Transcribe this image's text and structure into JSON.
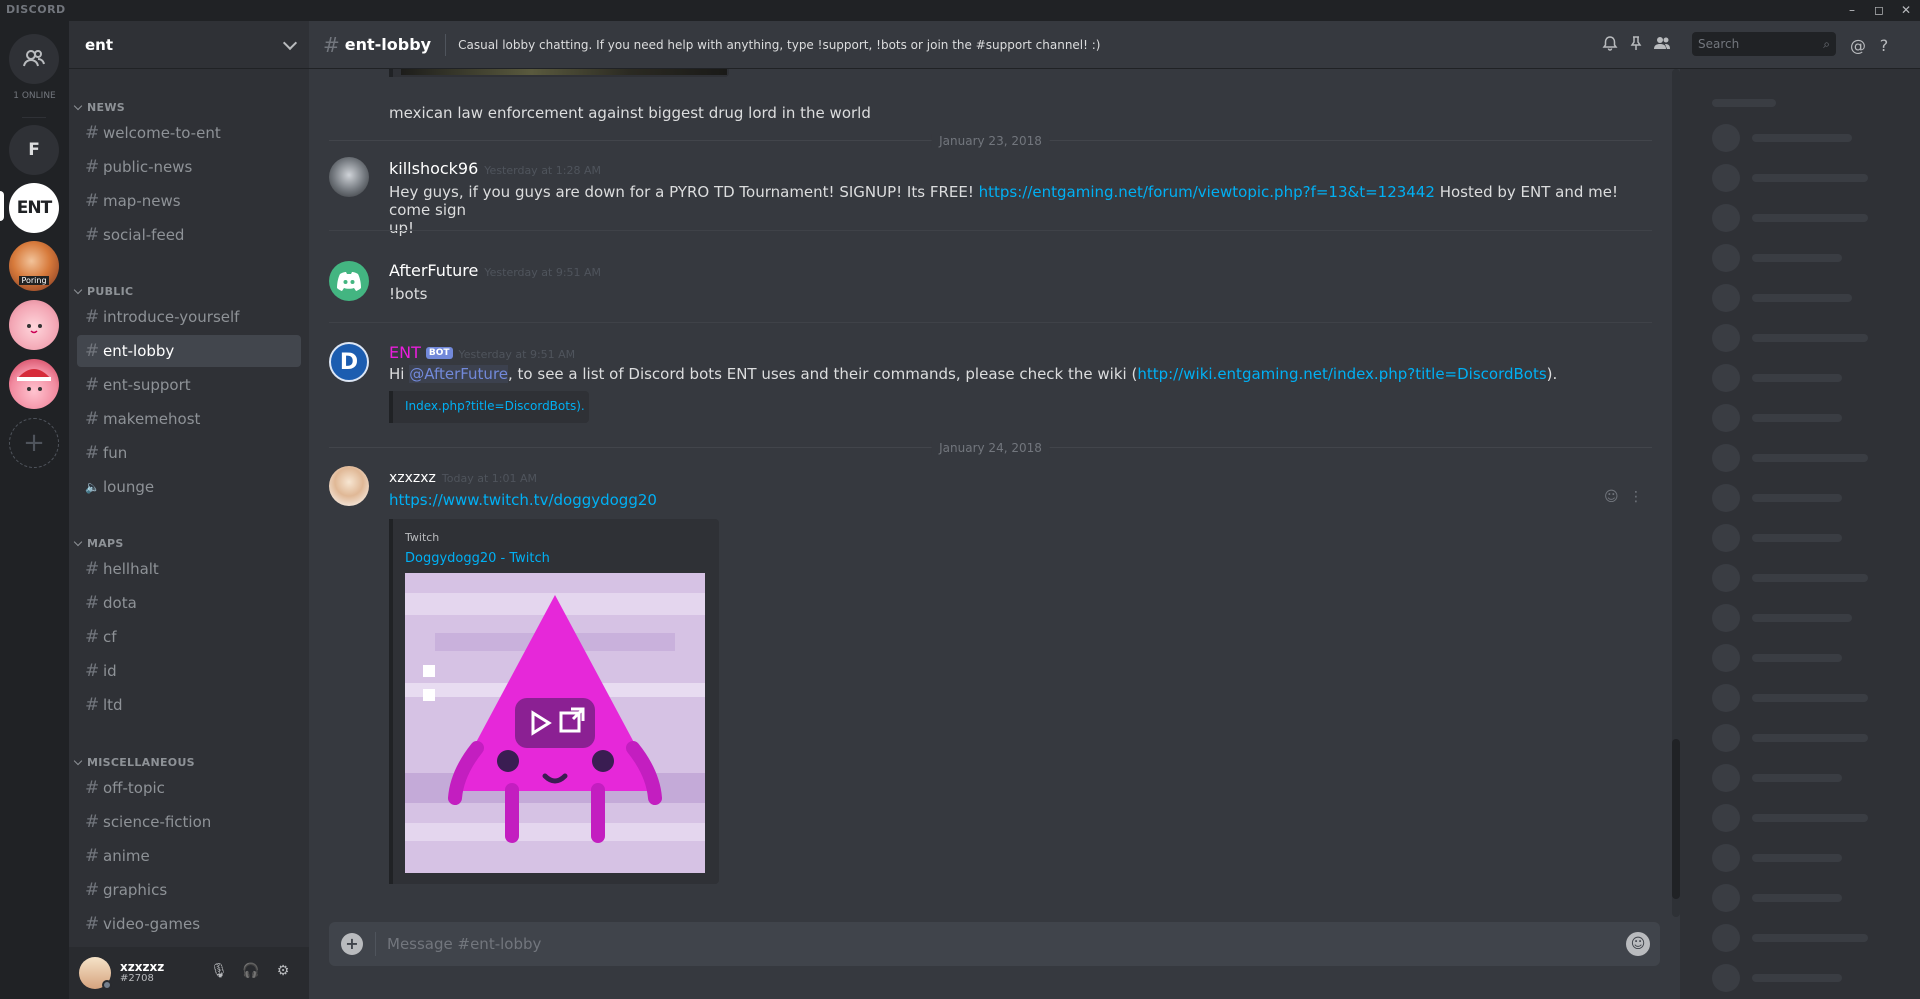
{
  "app": {
    "brand": "DISCORD"
  },
  "window": {
    "minimize": "–",
    "maximize": "◻",
    "close": "✕"
  },
  "guilds": {
    "online_label": "1 ONLINE",
    "items": [
      {
        "name": "friends",
        "label": "👥"
      },
      {
        "name": "f",
        "label": "F"
      },
      {
        "name": "ent",
        "label": "ENT"
      },
      {
        "name": "poring",
        "label": "Poring"
      },
      {
        "name": "pink-blob",
        "label": ""
      },
      {
        "name": "santa-blob",
        "label": ""
      }
    ],
    "add_label": "+"
  },
  "server": {
    "name": "ent"
  },
  "categories": [
    {
      "name": "NEWS",
      "channels": [
        "welcome-to-ent",
        "public-news",
        "map-news",
        "social-feed"
      ]
    },
    {
      "name": "PUBLIC",
      "channels": [
        "introduce-yourself",
        "ent-lobby",
        "ent-support",
        "makemehost",
        "fun",
        "lounge"
      ]
    },
    {
      "name": "MAPS",
      "channels": [
        "hellhalt",
        "dota",
        "cf",
        "id",
        "ltd"
      ]
    },
    {
      "name": "MISCELLANEOUS",
      "channels": [
        "off-topic",
        "science-fiction",
        "anime",
        "graphics",
        "video-games"
      ]
    }
  ],
  "user": {
    "name": "xzxzxz",
    "discriminator": "#2708"
  },
  "channel": {
    "name": "ent-lobby",
    "topic": "Casual lobby chatting. If you need help with anything, type !support, !bots or join the #support channel! :)"
  },
  "search": {
    "placeholder": "Search"
  },
  "messages": {
    "m0_text": "mexican law enforcement against biggest drug lord in the world",
    "date1": "January 23, 2018",
    "m1": {
      "author": "killshock96",
      "time": "Yesterday at 1:28 AM",
      "text_a": "Hey guys, if you guys are down for a PYRO TD Tournament! SIGNUP! Its FREE! ",
      "link": "https://entgaming.net/forum/viewtopic.php?f=13&t=123442",
      "text_b": "  Hosted by ENT and me! come sign",
      "text_c": "up!"
    },
    "m2": {
      "author": "AfterFuture",
      "time": "Yesterday at 9:51 AM",
      "text": "!bots"
    },
    "m3": {
      "author": "ENT",
      "bot_tag": "BOT",
      "time": "Yesterday at 9:51 AM",
      "text_a": "Hi ",
      "mention": "@AfterFuture",
      "text_b": ", to see a list of Discord bots ENT uses and their commands, please check the wiki (",
      "link": "http://wiki.entgaming.net/index.php?title=DiscordBots",
      "text_c": ").",
      "embed_link": "Index.php?title=DiscordBots)."
    },
    "date2": "January 24, 2018",
    "m4": {
      "author": "xzxzxz",
      "time": "Today at 1:01 AM",
      "link": "https://www.twitch.tv/doggydogg20",
      "embed_provider": "Twitch",
      "embed_title": "Doggydogg20 - Twitch"
    }
  },
  "composer": {
    "placeholder": "Message #ent-lobby"
  },
  "colors": {
    "accent": "#7289da",
    "link": "#00b0f4",
    "ent_author": "#e91edb"
  }
}
